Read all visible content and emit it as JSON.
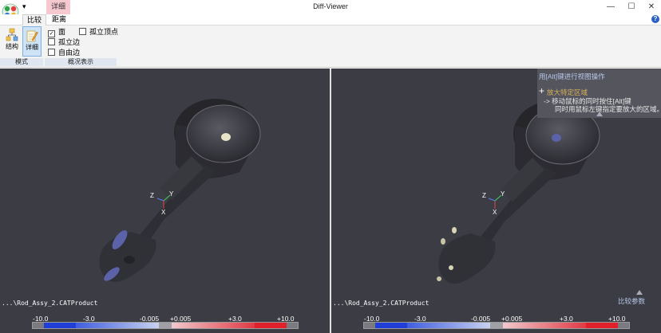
{
  "titlebar": {
    "title": "Diff-Viewer",
    "qa_arrow": "▾",
    "context_tab": "详细",
    "min": "—",
    "max": "☐",
    "close": "✕"
  },
  "tabs": [
    "比较",
    "距离"
  ],
  "help": "?",
  "ribbon": {
    "mode_buttons": [
      {
        "label": "结构",
        "active": false
      },
      {
        "label": "详细",
        "active": true
      }
    ],
    "mode_group": "模式",
    "checks": [
      {
        "label": "面",
        "checked": true
      },
      {
        "label": "孤立顶点",
        "checked": false
      },
      {
        "label": "孤立边",
        "checked": false
      },
      {
        "label": "自由边",
        "checked": false
      }
    ],
    "overview_group": "概况表示"
  },
  "viewports": [
    {
      "file_path": "...\\Rod_Assy_2.CATProduct",
      "axes": {
        "x": "X",
        "y": "Y",
        "z": "Z"
      },
      "scale": {
        "min": "-10.0",
        "neg_mid": "-3.0",
        "neg_small": "-0.005",
        "pos_small": "+0.005",
        "pos_mid": "+3.0",
        "max": "+10.0"
      }
    },
    {
      "file_path": "...\\Rod_Assy_2.CATProduct",
      "axes": {
        "x": "X",
        "y": "Y",
        "z": "Z"
      },
      "scale": {
        "min": "-10.0",
        "neg_mid": "-3.0",
        "neg_small": "-0.005",
        "pos_small": "+0.005",
        "pos_mid": "+3.0",
        "max": "+10.0"
      }
    }
  ],
  "hint": {
    "title": "用[Alt]键进行视图操作",
    "sub": "放大特定区域",
    "line1": "-> 移动鼠标的同时按住[Alt]键",
    "line2": "同时用鼠标左键指定要放大的区域。"
  },
  "params_link": "比较参数",
  "colors": {
    "viewport_bg": "#3c3c44",
    "ribbon_bg": "#f3f3f3",
    "context_tab": "#f6c8cf",
    "scale_blue": "#1f3fd8",
    "scale_red": "#e0202a"
  }
}
